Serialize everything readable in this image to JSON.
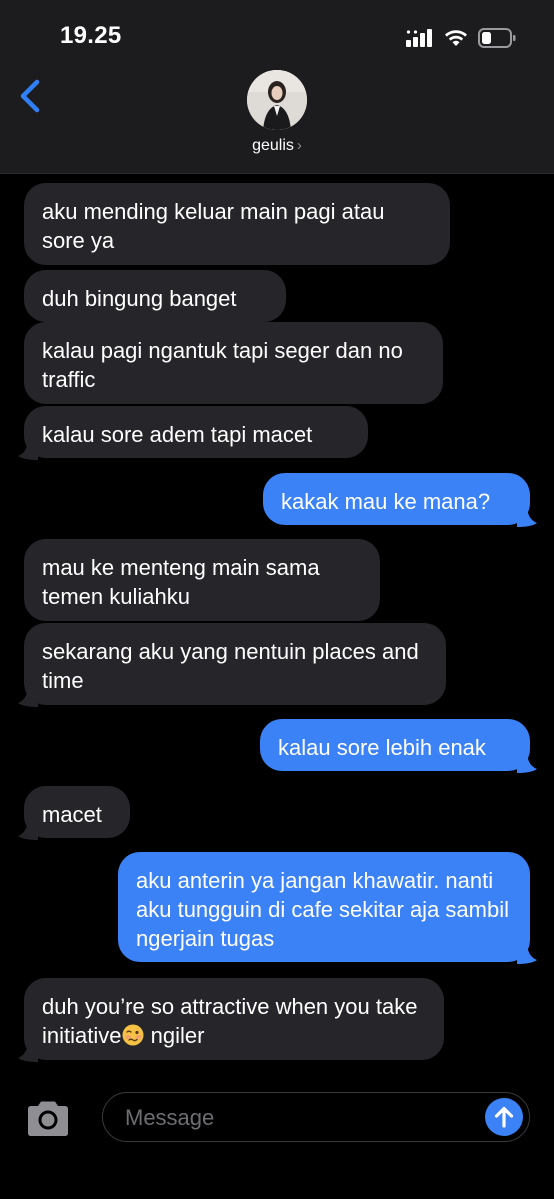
{
  "status_bar": {
    "time": "19.25"
  },
  "header": {
    "contact_name": "geulis",
    "chevron": "›"
  },
  "messages": [
    {
      "side": "in",
      "text": "aku mending keluar main pagi atau sore ya"
    },
    {
      "side": "in",
      "text": "duh bingung banget"
    },
    {
      "side": "in",
      "text": "kalau pagi ngantuk tapi seger dan no traffic"
    },
    {
      "side": "in",
      "text": "kalau sore adem tapi macet"
    },
    {
      "side": "out",
      "text": "kakak mau ke mana?"
    },
    {
      "side": "in",
      "text": "mau ke menteng main sama temen kuliahku"
    },
    {
      "side": "in",
      "text": "sekarang aku yang nentuin places and time"
    },
    {
      "side": "out",
      "text": "kalau sore lebih enak"
    },
    {
      "side": "in",
      "text": "macet"
    },
    {
      "side": "out",
      "text": "aku anterin ya jangan khawatir. nanti aku tungguin di cafe sekitar aja sambil ngerjain tugas"
    },
    {
      "side": "in",
      "text_before": "duh you’re so attractive when you take initiative",
      "text_after": " ngiler",
      "emoji": "woozy-face"
    }
  ],
  "composer": {
    "placeholder": "Message"
  },
  "colors": {
    "incoming_bubble": "#26252a",
    "outgoing_bubble": "#3b82f6",
    "accent": "#2f7ff6",
    "header_bg": "#1c1c1e"
  },
  "icons": {
    "back": "chevron-left-icon",
    "camera": "camera-icon",
    "send": "arrow-up-icon",
    "signal": "signal-icon",
    "wifi": "wifi-icon",
    "battery": "battery-icon"
  }
}
